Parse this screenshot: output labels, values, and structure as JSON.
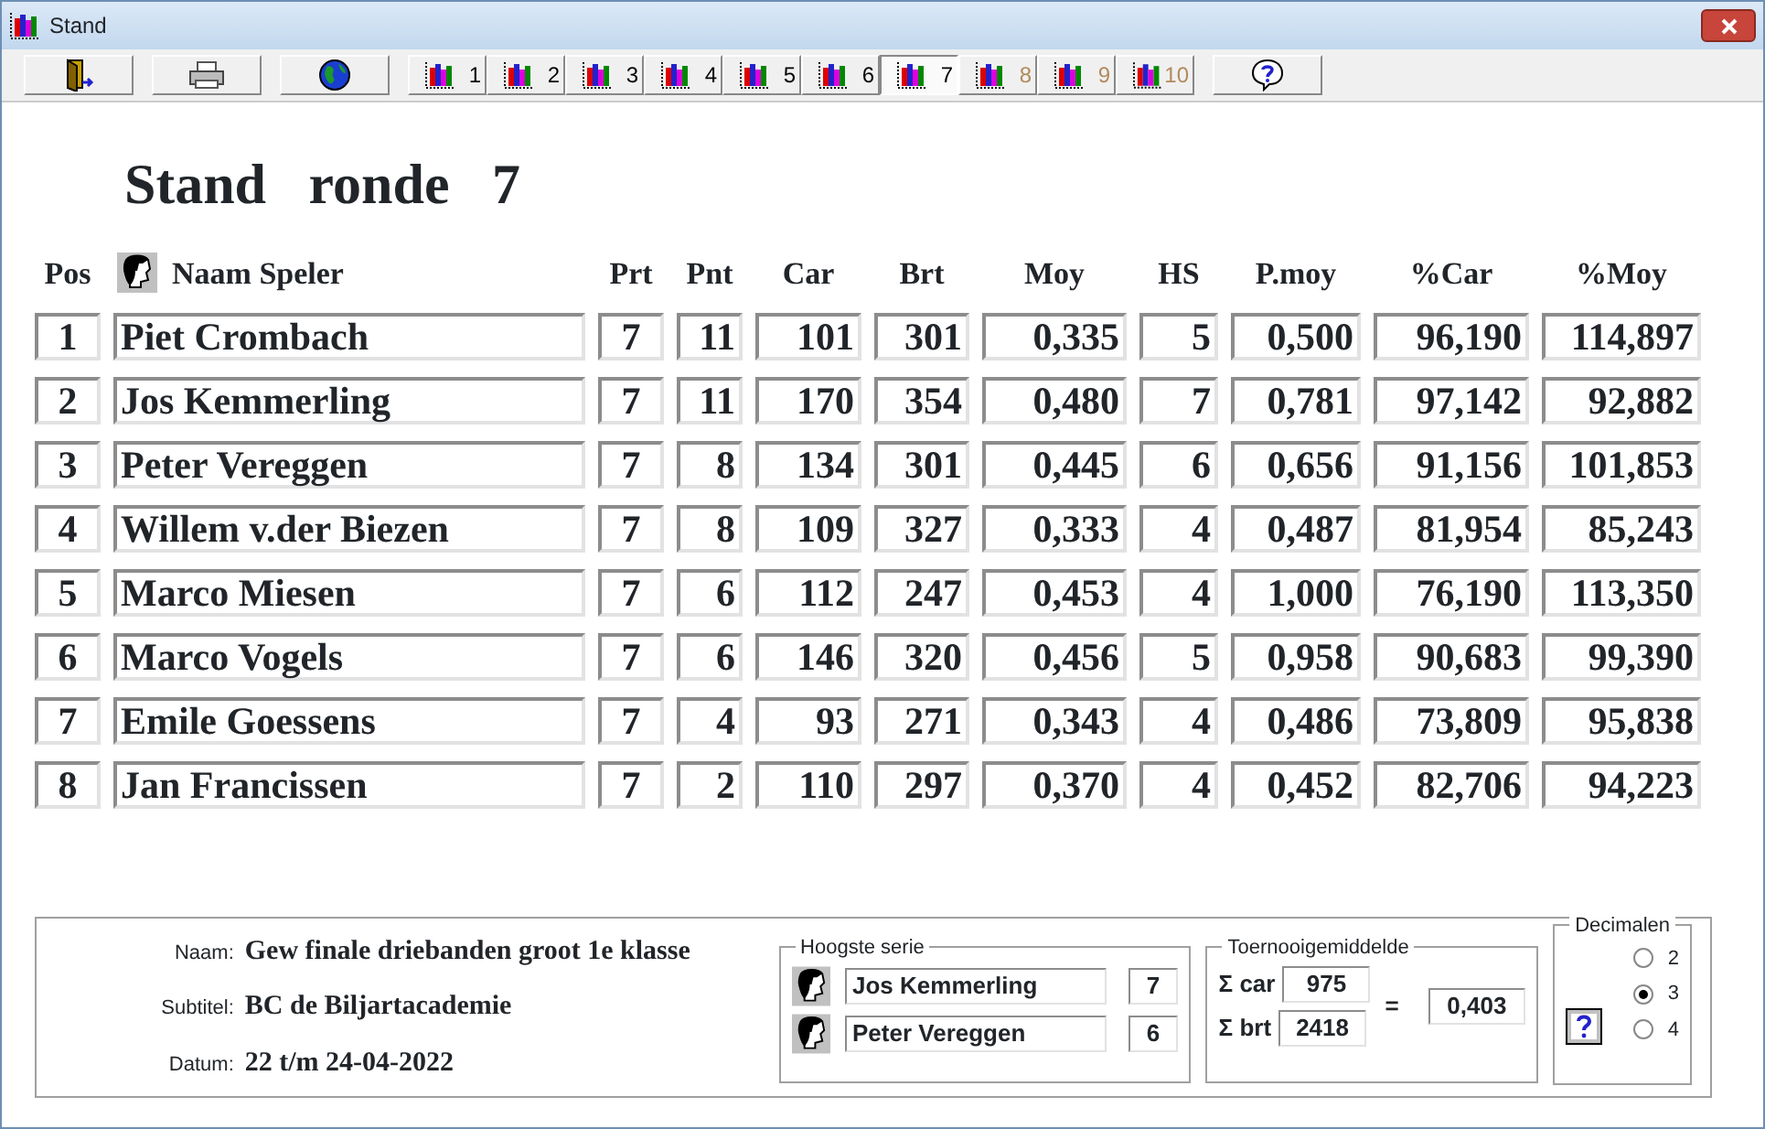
{
  "window": {
    "title": "Stand"
  },
  "toolbar": [
    {
      "kind": "exit",
      "selected": false
    },
    {
      "kind": "print",
      "selected": false
    },
    {
      "kind": "globe",
      "selected": false
    },
    {
      "kind": "round",
      "label": "1",
      "selected": false,
      "disabled": false
    },
    {
      "kind": "round",
      "label": "2",
      "selected": false,
      "disabled": false
    },
    {
      "kind": "round",
      "label": "3",
      "selected": false,
      "disabled": false
    },
    {
      "kind": "round",
      "label": "4",
      "selected": false,
      "disabled": false
    },
    {
      "kind": "round",
      "label": "5",
      "selected": false,
      "disabled": false
    },
    {
      "kind": "round",
      "label": "6",
      "selected": false,
      "disabled": false
    },
    {
      "kind": "round",
      "label": "7",
      "selected": true,
      "disabled": false
    },
    {
      "kind": "round",
      "label": "8",
      "selected": false,
      "disabled": true
    },
    {
      "kind": "round",
      "label": "9",
      "selected": false,
      "disabled": true
    },
    {
      "kind": "round",
      "label": "10",
      "selected": false,
      "disabled": true
    },
    {
      "kind": "help",
      "selected": false
    }
  ],
  "heading": [
    "Stand",
    "ronde",
    "7"
  ],
  "table": {
    "columns": [
      "Pos",
      "Naam Speler",
      "Prt",
      "Pnt",
      "Car",
      "Brt",
      "Moy",
      "HS",
      "P.moy",
      "%Car",
      "%Moy"
    ],
    "rows": [
      [
        "1",
        "Piet Crombach",
        "7",
        "11",
        "101",
        "301",
        "0,335",
        "5",
        "0,500",
        "96,190",
        "114,897"
      ],
      [
        "2",
        "Jos Kemmerling",
        "7",
        "11",
        "170",
        "354",
        "0,480",
        "7",
        "0,781",
        "97,142",
        "92,882"
      ],
      [
        "3",
        "Peter Vereggen",
        "7",
        "8",
        "134",
        "301",
        "0,445",
        "6",
        "0,656",
        "91,156",
        "101,853"
      ],
      [
        "4",
        "Willem v.der Biezen",
        "7",
        "8",
        "109",
        "327",
        "0,333",
        "4",
        "0,487",
        "81,954",
        "85,243"
      ],
      [
        "5",
        "Marco Miesen",
        "7",
        "6",
        "112",
        "247",
        "0,453",
        "4",
        "1,000",
        "76,190",
        "113,350"
      ],
      [
        "6",
        "Marco Vogels",
        "7",
        "6",
        "146",
        "320",
        "0,456",
        "5",
        "0,958",
        "90,683",
        "99,390"
      ],
      [
        "7",
        "Emile Goessens",
        "7",
        "4",
        "93",
        "271",
        "0,343",
        "4",
        "0,486",
        "73,809",
        "95,838"
      ],
      [
        "8",
        "Jan Francissen",
        "7",
        "2",
        "110",
        "297",
        "0,370",
        "4",
        "0,452",
        "82,706",
        "94,223"
      ]
    ]
  },
  "info": [
    {
      "label": "Naam:",
      "value": "Gew finale driebanden groot 1e klasse"
    },
    {
      "label": "Subtitel:",
      "value": "BC de Biljartacademie"
    },
    {
      "label": "Datum:",
      "value": "22 t/m 24-04-2022"
    }
  ],
  "highest_series": {
    "title": "Hoogste serie",
    "rows": [
      {
        "name": "Jos Kemmerling",
        "value": "7"
      },
      {
        "name": "Peter Vereggen",
        "value": "6"
      }
    ]
  },
  "tournament_average": {
    "title": "Toernooigemiddelde",
    "car_label": "Σ car",
    "car": "975",
    "brt_label": "Σ brt",
    "brt": "2418",
    "equals": "=",
    "result": "0,403"
  },
  "decimals": {
    "title": "Decimalen",
    "options": [
      {
        "label": "2",
        "selected": false
      },
      {
        "label": "3",
        "selected": true
      },
      {
        "label": "4",
        "selected": false
      }
    ]
  }
}
